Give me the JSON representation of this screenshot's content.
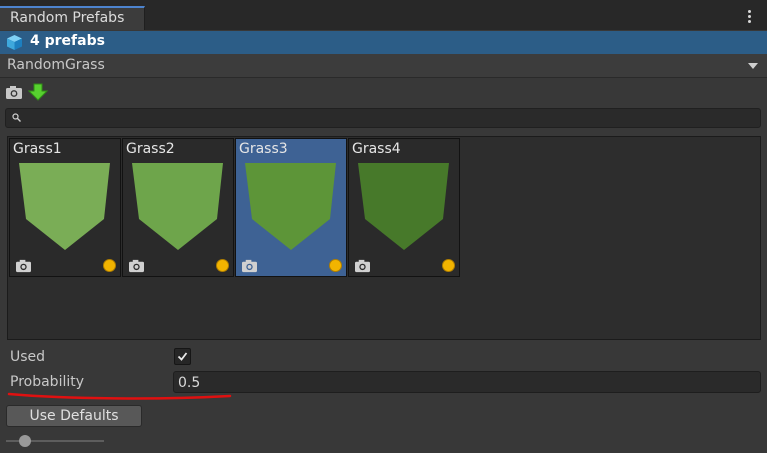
{
  "window": {
    "tab_title": "Random Prefabs",
    "menu_icon": "kebab-menu-icon"
  },
  "header": {
    "icon": "prefab-cube-icon",
    "count_label": "4 prefabs",
    "background": "#2c5d87"
  },
  "prefab_set": {
    "selected": "RandomGrass"
  },
  "toolbar": {
    "icons": [
      "camera-icon",
      "download-arrow-icon"
    ]
  },
  "search": {
    "value": "",
    "placeholder": ""
  },
  "prefabs": [
    {
      "name": "Grass1",
      "color": "#7aad56",
      "selected": false
    },
    {
      "name": "Grass2",
      "color": "#6ea54b",
      "selected": false
    },
    {
      "name": "Grass3",
      "color": "#5d9538",
      "selected": true
    },
    {
      "name": "Grass4",
      "color": "#47792a",
      "selected": false
    }
  ],
  "properties": {
    "used_label": "Used",
    "used_checked": true,
    "probability_label": "Probability",
    "probability_value": "0.5"
  },
  "actions": {
    "use_defaults_label": "Use Defaults"
  },
  "thumbnail_size_slider": {
    "value": 0.15
  },
  "colors": {
    "selection": "#3e6294",
    "annotation": "#e01010",
    "status_dot": "#f2b400"
  }
}
